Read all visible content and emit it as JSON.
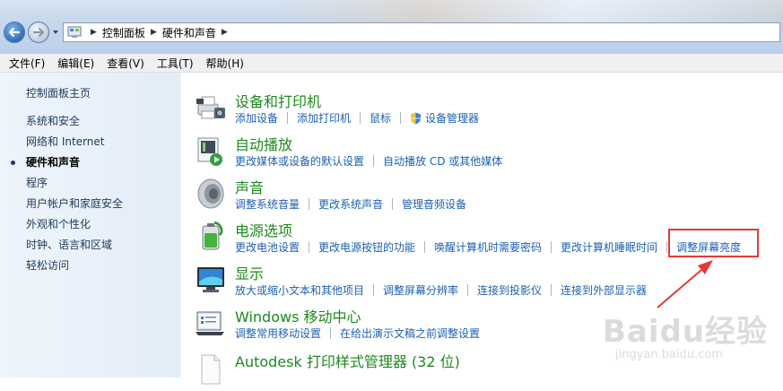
{
  "address": {
    "crumbs": [
      "控制面板",
      "硬件和声音"
    ]
  },
  "menu": [
    "文件(F)",
    "编辑(E)",
    "查看(V)",
    "工具(T)",
    "帮助(H)"
  ],
  "sidebar": {
    "home": "控制面板主页",
    "items": [
      {
        "label": "系统和安全"
      },
      {
        "label": "网络和 Internet"
      },
      {
        "label": "硬件和声音"
      },
      {
        "label": "程序"
      },
      {
        "label": "用户帐户和家庭安全"
      },
      {
        "label": "外观和个性化"
      },
      {
        "label": "时钟、语言和区域"
      },
      {
        "label": "轻松访问"
      }
    ]
  },
  "categories": [
    {
      "title": "设备和打印机",
      "icon": "printer-icon",
      "links": [
        "添加设备",
        "添加打印机",
        "鼠标",
        "设备管理器"
      ]
    },
    {
      "title": "自动播放",
      "icon": "autoplay-icon",
      "links": [
        "更改媒体或设备的默认设置",
        "自动播放 CD 或其他媒体"
      ]
    },
    {
      "title": "声音",
      "icon": "speaker-icon",
      "links": [
        "调整系统音量",
        "更改系统声音",
        "管理音频设备"
      ]
    },
    {
      "title": "电源选项",
      "icon": "battery-icon",
      "links": [
        "更改电池设置",
        "更改电源按钮的功能",
        "唤醒计算机时需要密码",
        "更改计算机睡眠时间",
        "调整屏幕亮度"
      ]
    },
    {
      "title": "显示",
      "icon": "display-icon",
      "links": [
        "放大或缩小文本和其他项目",
        "调整屏幕分辨率",
        "连接到投影仪",
        "连接到外部显示器"
      ]
    },
    {
      "title": "Windows 移动中心",
      "icon": "mobility-center-icon",
      "links": [
        "调整常用移动设置",
        "在给出演示文稿之前调整设置"
      ]
    },
    {
      "title": "Autodesk 打印样式管理器 (32 位)",
      "icon": "document-icon",
      "links": []
    }
  ],
  "watermark": {
    "logo": "Baidu经验",
    "url": "jingyan.baidu.com"
  },
  "colors": {
    "highlight": "#e53935",
    "link": "#1c60b5",
    "category_title": "#1c8a1c"
  }
}
